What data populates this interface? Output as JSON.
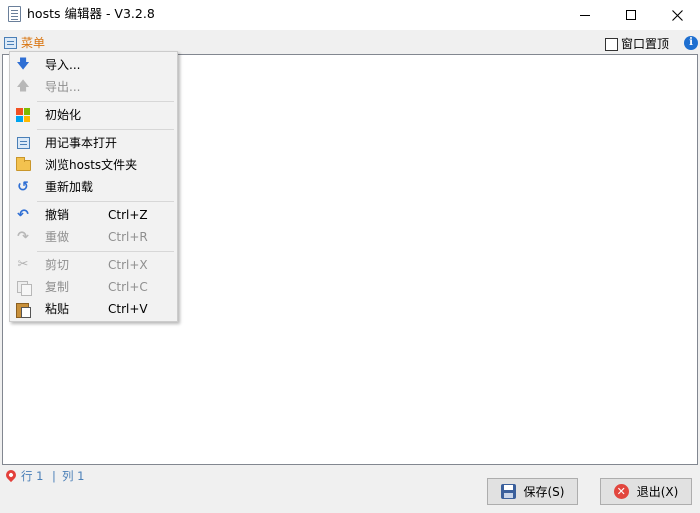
{
  "window": {
    "title": "hosts 编辑器 - V3.2.8"
  },
  "menubar": {
    "menu_label": "菜单",
    "always_on_top_label": "窗口置顶",
    "always_on_top_checked": false,
    "info_icon": "info-icon"
  },
  "context_menu": {
    "items": [
      {
        "label": "导入...",
        "shortcut": "",
        "enabled": true,
        "icon": "arrow-down-icon"
      },
      {
        "label": "导出...",
        "shortcut": "",
        "enabled": false,
        "icon": "arrow-up-icon"
      },
      {
        "label": "初始化",
        "shortcut": "",
        "enabled": true,
        "icon": "windows-logo-icon"
      },
      {
        "label": "用记事本打开",
        "shortcut": "",
        "enabled": true,
        "icon": "notepad-icon"
      },
      {
        "label": "浏览hosts文件夹",
        "shortcut": "",
        "enabled": true,
        "icon": "folder-icon"
      },
      {
        "label": "重新加载",
        "shortcut": "",
        "enabled": true,
        "icon": "reload-icon"
      },
      {
        "label": "撤销",
        "shortcut": "Ctrl+Z",
        "enabled": true,
        "icon": "undo-icon"
      },
      {
        "label": "重做",
        "shortcut": "Ctrl+R",
        "enabled": false,
        "icon": "redo-icon"
      },
      {
        "label": "剪切",
        "shortcut": "Ctrl+X",
        "enabled": false,
        "icon": "cut-icon"
      },
      {
        "label": "复制",
        "shortcut": "Ctrl+C",
        "enabled": false,
        "icon": "copy-icon"
      },
      {
        "label": "粘贴",
        "shortcut": "Ctrl+V",
        "enabled": true,
        "icon": "paste-icon"
      }
    ]
  },
  "editor": {
    "content": ""
  },
  "status": {
    "row_label": "行 1",
    "separator": "|",
    "col_label": "列 1"
  },
  "buttons": {
    "save_label": "保存(S)",
    "exit_label": "退出(X)"
  },
  "colors": {
    "menu_accent": "#d9730d",
    "status_text": "#4a7fb7",
    "info_icon": "#1e6fd0",
    "exit_icon": "#e2463e"
  }
}
